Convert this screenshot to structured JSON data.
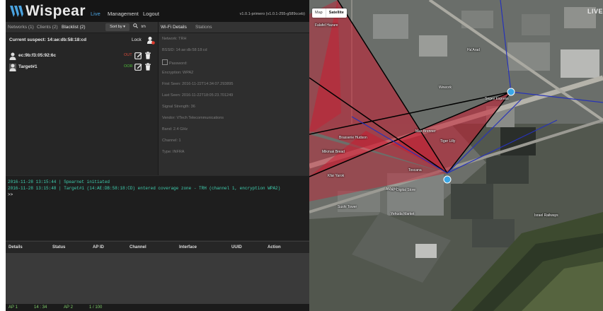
{
  "app": {
    "logo_text": "Wispear",
    "nav": [
      {
        "label": "Live",
        "active": true
      },
      {
        "label": "Management"
      },
      {
        "label": "Logout"
      }
    ],
    "version": "v1.0.1-primero (v1.0.1-255-g589cceb)"
  },
  "left_tabs": [
    {
      "label": "Networks (1)"
    },
    {
      "label": "Clients (2)"
    },
    {
      "label": "Blacklist (2)",
      "active": true
    }
  ],
  "sort_label": "Sort by ▾",
  "search_value": "trh",
  "current_suspect": "Current suspect: 14:ae:db:58:18:cd",
  "lock_label": "Lock",
  "blacklist": [
    {
      "name": "ec:9b:f3:05:92:6c",
      "status": "OUT",
      "status_color": "#d94a3a"
    },
    {
      "name": "Target#1",
      "status": "OOR",
      "status_color": "#4fbf3a"
    }
  ],
  "detail_tabs": [
    {
      "label": "Wi-Fi Details",
      "active": true
    },
    {
      "label": "Stations"
    }
  ],
  "details": {
    "network": "Network: TRH",
    "bssid": "BSSID: 14:ae:db:58:18:cd",
    "password": "Password:",
    "encryption": "Encryption: WPA2",
    "first_seen": "First Seen: 2016-11-22T14:34:07.293895",
    "last_seen": "Last Seen: 2016-11-22T18:05:23.701249",
    "signal": "Signal Strength: 36",
    "vendor": "Vendor: VTech Telecommunications",
    "band": "Band: 2.4 GHz",
    "channel": "Channel: 1",
    "type": "Type: INFRA"
  },
  "console": [
    "2016-11-28 13:15:44 | Spearnet initiated",
    "2016-11-28 13:15:48 | Target#1 (14:AE:DB:58:18:CD) entered coverage zone - TRH (channel 1, encryption WPA2)",
    ">>"
  ],
  "table_columns": [
    "Details",
    "Status",
    "AP ID",
    "Channel",
    "Interface",
    "UUID",
    "Action"
  ],
  "footer": [
    "AP 1",
    "14 : 34",
    "AP 2",
    "1 / 100"
  ],
  "map": {
    "toggle": [
      "Map",
      "Satellite"
    ],
    "selected": "Satellite",
    "live_label": "LIVE",
    "places": [
      "Falafel Hazare",
      "Ha'Arad",
      "Wework",
      "Segev Express",
      "Brasserie Hudson",
      "Max Brenner",
      "Mikmak Bread",
      "Toscana",
      "Tiger Lilly",
      "Kfar Yarok",
      "AM PM",
      "AP Digital Store",
      "Sushi Tower",
      "Yehuda Market",
      "Israel Railways"
    ]
  }
}
